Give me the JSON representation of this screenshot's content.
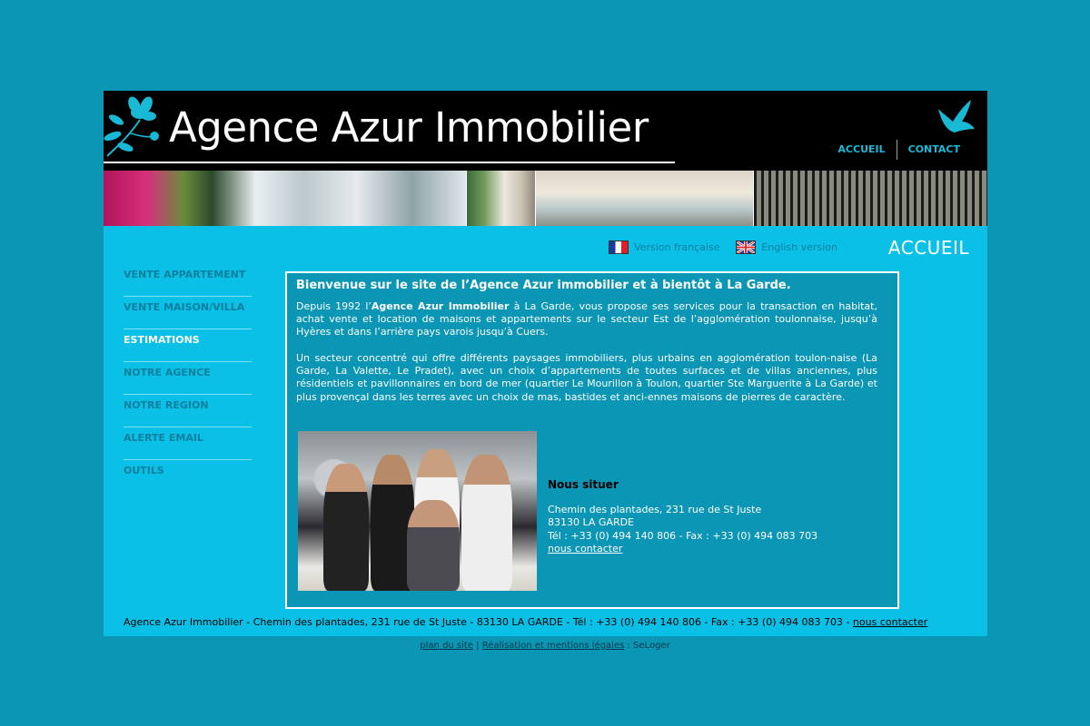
{
  "header": {
    "logo_text": "Agence Azur Immobilier",
    "nav": [
      {
        "label": "ACCUEIL"
      },
      {
        "label": "CONTACT"
      }
    ]
  },
  "lang": {
    "fr_label": "Version française",
    "en_label": "English version"
  },
  "page_title": "ACCUEIL",
  "sidebar": {
    "items": [
      {
        "label": "VENTE APPARTEMENT"
      },
      {
        "label": "VENTE MAISON/VILLA"
      },
      {
        "label": "ESTIMATIONS"
      },
      {
        "label": "NOTRE AGENCE"
      },
      {
        "label": "NOTRE REGION"
      },
      {
        "label": "ALERTE EMAIL"
      },
      {
        "label": "OUTILS"
      }
    ]
  },
  "content": {
    "title": "Bienvenue sur le site de l’Agence Azur immobilier et à bientôt à La Garde.",
    "para1_pre": "Depuis 1992 l’",
    "para1_bold": "Agence Azur Immobilier",
    "para1_post": " à La Garde, vous propose ses services pour la transaction en habitat, achat vente et location de maisons et appartements sur le secteur Est de l’agglomération toulonnaise, jusqu’à Hyères et dans l’arrière pays varois jusqu’à Cuers.",
    "para2": "Un secteur concentré qui offre différents paysages immobiliers, plus urbains en agglomération toulon-naise (La Garde, La Valette, Le Pradet), avec un choix d’appartements de toutes surfaces et de villas anciennes, plus résidentiels et pavillonnaires en bord de mer (quartier Le Mourillon à Toulon, quartier Ste Marguerite à La Garde) et plus provençal dans les terres avec un choix de mas, bastides et anci-ennes maisons de pierres de caractère.",
    "locate_title": "Nous situer",
    "address1": "Chemin des plantades, 231 rue de St Juste",
    "address2": "83130 LA GARDE",
    "phone": "Tél : +33 (0) 494 140 806 - Fax : +33 (0) 494 083 703",
    "contact_link": "nous contacter"
  },
  "footer": {
    "text": "Agence Azur Immobilier - Chemin des plantades, 231 rue de St Juste - 83130 LA GARDE - Tél : +33 (0) 494 140 806 - Fax : +33 (0) 494 083 703 - ",
    "contact_link": "nous contacter",
    "sitemap": "plan du site",
    "sep": " | ",
    "legal": "Réalisation et mentions légales",
    "credit": " : SeLoger"
  }
}
